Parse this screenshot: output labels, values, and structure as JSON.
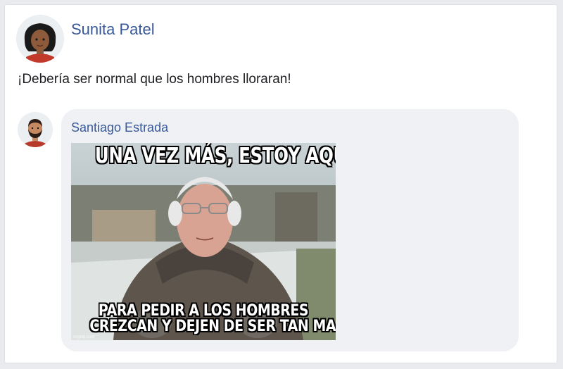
{
  "post": {
    "author": "Sunita Patel",
    "text": "¡Debería ser normal que los hombres lloraran!"
  },
  "reply": {
    "author": "Santiago Estrada",
    "meme": {
      "top_text": "UNA VEZ MÁS, ESTOY AQUÍ",
      "bottom_line1": "PARA PEDIR A LOS HOMBRES",
      "bottom_line2": "CREZCAN Y DEJEN DE SER TAN MARICAS",
      "watermark": "imgflip.com"
    }
  },
  "colors": {
    "name_link": "#385898",
    "bubble": "#eff1f4",
    "background": "#e9ebee"
  }
}
